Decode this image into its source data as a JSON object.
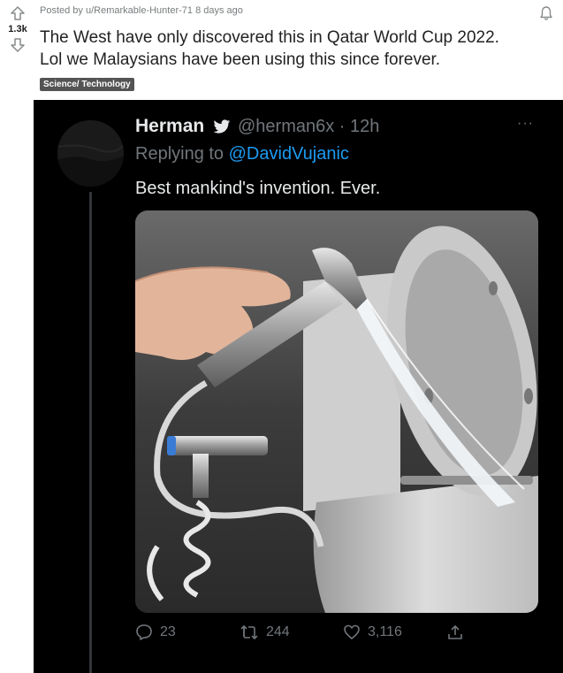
{
  "post": {
    "meta": "Posted by u/Remarkable-Hunter-71 8 days ago",
    "score": "1.3k",
    "title_line1": "The West have only discovered this in Qatar World Cup 2022.",
    "title_line2": "Lol we Malaysians have been using this since forever.",
    "flair": "Science/ Technology",
    "icons": {
      "upvote": "upvote-arrow-icon",
      "downvote": "downvote-arrow-icon",
      "bell": "bell-icon"
    }
  },
  "tweet": {
    "name": "Herman",
    "handle_time": "@herman6x · 12h",
    "more": "···",
    "reply_prefix": "Replying to ",
    "reply_mention": "@DavidVujanic",
    "text": "Best mankind's invention. Ever.",
    "counts": {
      "replies": "23",
      "retweets": "244",
      "likes": "3,116"
    },
    "colors": {
      "link": "#1d9bf0",
      "muted": "#71767b",
      "text": "#e7e9ea"
    }
  }
}
